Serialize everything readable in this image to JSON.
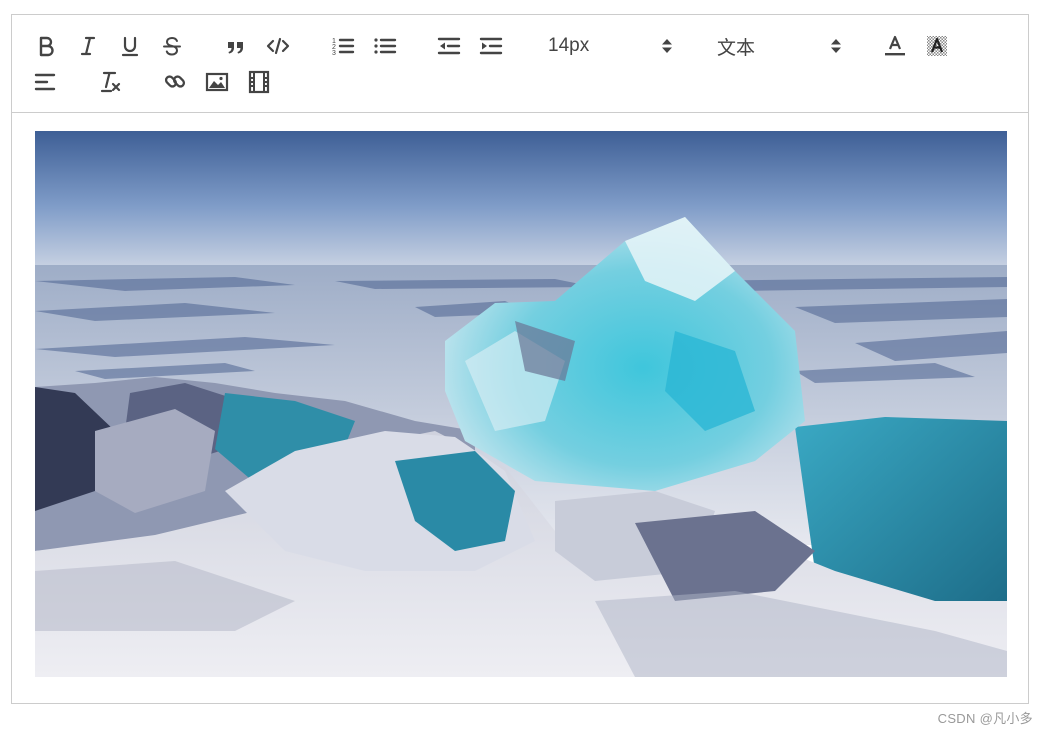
{
  "toolbar": {
    "buttons_row1": [
      {
        "name": "bold-button",
        "icon": "bold-icon"
      },
      {
        "name": "italic-button",
        "icon": "italic-icon"
      },
      {
        "name": "underline-button",
        "icon": "underline-icon"
      },
      {
        "name": "strike-button",
        "icon": "strike-icon"
      },
      {
        "name": "blockquote-button",
        "icon": "quote-icon"
      },
      {
        "name": "code-block-button",
        "icon": "code-icon"
      },
      {
        "name": "ordered-list-button",
        "icon": "ordered-list-icon"
      },
      {
        "name": "bullet-list-button",
        "icon": "bullet-list-icon"
      },
      {
        "name": "outdent-button",
        "icon": "outdent-icon"
      },
      {
        "name": "indent-button",
        "icon": "indent-icon"
      }
    ],
    "font_size": {
      "value": "14px"
    },
    "header": {
      "value": "文本"
    },
    "color_icons": [
      "text-color-icon",
      "background-color-icon"
    ],
    "buttons_row2": [
      {
        "name": "align-button",
        "icon": "align-left-icon"
      },
      {
        "name": "clean-format-button",
        "icon": "clear-format-icon"
      },
      {
        "name": "link-button",
        "icon": "link-icon"
      },
      {
        "name": "image-button",
        "icon": "image-icon"
      },
      {
        "name": "video-button",
        "icon": "video-icon"
      }
    ]
  },
  "content": {
    "image": {
      "subject": "turquoise ice blocks on frozen lake under blue sky"
    }
  },
  "watermark": {
    "text": "CSDN @凡小多"
  },
  "colors": {
    "border": "#cccccc",
    "icon": "#444444",
    "watermark": "#999999",
    "sky_top": "#3e5f96",
    "ice": "#3fc6dc"
  }
}
